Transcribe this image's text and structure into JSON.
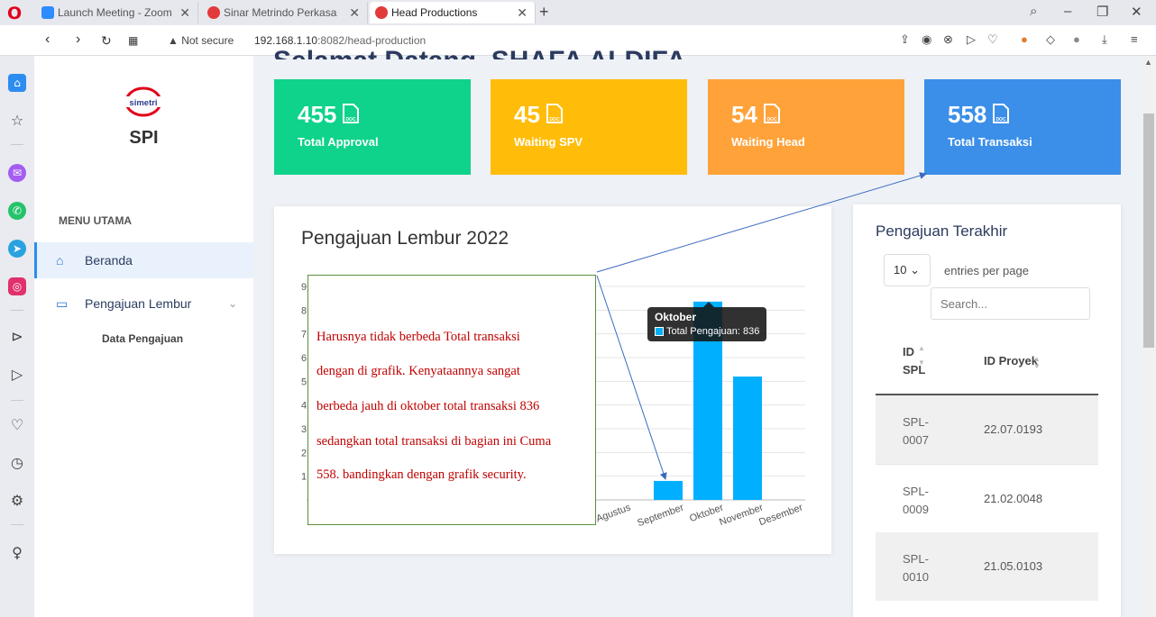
{
  "browser": {
    "tabs": [
      {
        "title": "Launch Meeting - Zoom",
        "color": "#2d8cff"
      },
      {
        "title": "Sinar Metrindo Perkasa",
        "color": "#e23a3a"
      },
      {
        "title": "Head Productions",
        "color": "#e23a3a"
      }
    ],
    "not_secure": "Not secure",
    "url_host": "192.168.1.10",
    "url_path": ":8082/head-production"
  },
  "sidebar": {
    "logo_text": "simetri",
    "brand": "SPI",
    "menu_heading": "MENU UTAMA",
    "items": [
      {
        "label": "Beranda",
        "icon": "home-icon"
      },
      {
        "label": "Pengajuan Lembur",
        "icon": "folder-icon"
      }
    ],
    "sub_items": [
      "Data Pengajuan"
    ]
  },
  "main": {
    "headline": "Selamat Datang, SHAFA ALDIFA",
    "cards": [
      {
        "value": "455",
        "label": "Total Approval",
        "color": "#0fd38a"
      },
      {
        "value": "45",
        "label": "Waiting SPV",
        "color": "#ffbd0a"
      },
      {
        "value": "54",
        "label": "Waiting Head",
        "color": "#ffa23a"
      },
      {
        "value": "558",
        "label": "Total Transaksi",
        "color": "#3b8fe8"
      }
    ]
  },
  "chart": {
    "title": "Pengajuan Lembur 2022",
    "tooltip": {
      "title": "Oktober",
      "text": "Total Pengajuan: 836"
    }
  },
  "chart_data": {
    "type": "bar",
    "title": "Pengajuan Lembur 2022",
    "categories": [
      "Agustus",
      "September",
      "Oktober",
      "November",
      "Desember"
    ],
    "series": [
      {
        "name": "Total Pengajuan",
        "values": [
          0,
          80,
          836,
          520,
          0
        ]
      }
    ],
    "y_ticks": [
      "1",
      "2",
      "3",
      "4",
      "5",
      "6",
      "7",
      "8",
      "9"
    ],
    "color": "#00b0ff",
    "grid": true
  },
  "note": {
    "lines": [
      "Harusnya tidak berbeda Total transaksi",
      "dengan di grafik. Kenyataannya sangat",
      "berbeda jauh di oktober total transaksi 836",
      "sedangkan total transaksi di bagian ini Cuma",
      "558. bandingkan dengan grafik security."
    ]
  },
  "recent": {
    "title": "Pengajuan Terakhir",
    "entries_value": "10",
    "entries_label": "entries per page",
    "search_placeholder": "Search...",
    "columns": [
      "ID SPL",
      "ID Proyek"
    ],
    "rows": [
      {
        "id": "SPL-0007",
        "proyek": "22.07.0193"
      },
      {
        "id": "SPL-0009",
        "proyek": "21.02.0048"
      },
      {
        "id": "SPL-0010",
        "proyek": "21.05.0103"
      }
    ]
  }
}
